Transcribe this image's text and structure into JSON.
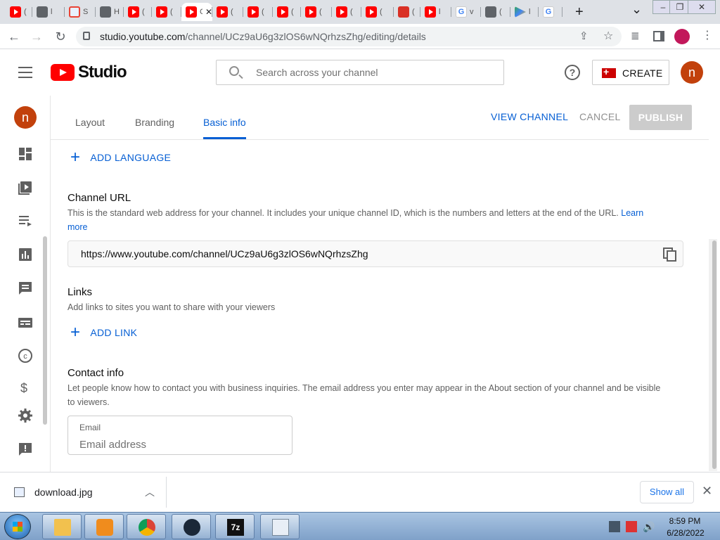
{
  "browser": {
    "tabs": [
      {
        "icon": "youtube-icon",
        "text": "("
      },
      {
        "icon": "globe-icon",
        "text": "l"
      },
      {
        "icon": "search-icon",
        "text": "S"
      },
      {
        "icon": "audio-icon",
        "text": "H"
      },
      {
        "icon": "youtube-icon",
        "text": "("
      },
      {
        "icon": "youtube-icon",
        "text": "("
      },
      {
        "icon": "youtube-studio-icon",
        "text": "C",
        "active": true
      },
      {
        "icon": "youtube-icon",
        "text": "("
      },
      {
        "icon": "youtube-icon",
        "text": "("
      },
      {
        "icon": "youtube-icon",
        "text": "("
      },
      {
        "icon": "youtube-icon",
        "text": "("
      },
      {
        "icon": "youtube-icon",
        "text": "("
      },
      {
        "icon": "youtube-icon",
        "text": "("
      },
      {
        "icon": "image-icon",
        "text": "("
      },
      {
        "icon": "youtube-icon",
        "text": "l"
      },
      {
        "icon": "google-icon",
        "text": "v"
      },
      {
        "icon": "globe-icon",
        "text": "("
      },
      {
        "icon": "play-store-icon",
        "text": "l"
      },
      {
        "icon": "google-icon",
        "text": ""
      }
    ],
    "new_tab": "+",
    "tab_search": "⌄",
    "url_host": "studio.youtube.com",
    "url_path": "/channel/UCz9aU6g3zlOS6wNQrhzsZhg/editing/details",
    "profile_initial": ""
  },
  "studio": {
    "logo_text": "Studio",
    "search_placeholder": "Search across your channel",
    "create_label": "CREATE",
    "avatar_initial": "n"
  },
  "tabs": {
    "items": [
      "Layout",
      "Branding",
      "Basic info"
    ],
    "active": "Basic info",
    "view_channel": "VIEW CHANNEL",
    "cancel": "CANCEL",
    "publish": "PUBLISH"
  },
  "content": {
    "add_language": "ADD LANGUAGE",
    "channel_url": {
      "title": "Channel URL",
      "desc": "This is the standard web address for your channel. It includes your unique channel ID, which is the numbers and letters at the end of the URL.",
      "learn_more_1": "Learn",
      "learn_more_2": "more",
      "value": "https://www.youtube.com/channel/UCz9aU6g3zlOS6wNQrhzsZhg"
    },
    "links": {
      "title": "Links",
      "desc": "Add links to sites you want to share with your viewers",
      "add_link": "ADD LINK"
    },
    "contact": {
      "title": "Contact info",
      "desc_1": "Let people know how to contact you with business inquiries. The email address you enter may appear in the About section of your channel and be visible",
      "desc_2": "to viewers.",
      "email_label": "Email",
      "email_placeholder": "Email address"
    }
  },
  "download": {
    "filename": "download.jpg",
    "show_all": "Show all"
  },
  "taskbar": {
    "time": "8:59 PM",
    "date": "6/28/2022"
  },
  "colors": {
    "accent_blue": "#065fd4",
    "youtube_red": "#ff0000",
    "avatar": "#c2410c"
  }
}
